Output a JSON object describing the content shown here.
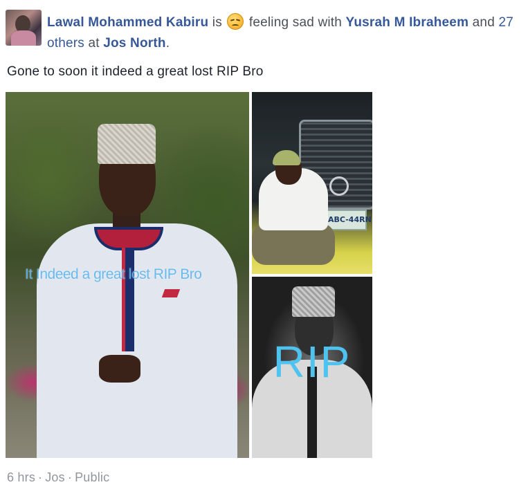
{
  "post": {
    "author": "Lawal Mohammed Kabiru",
    "is_word": "is",
    "feeling": "feeling sad with",
    "tagged_person": "Yusrah M Ibraheem",
    "and_word": "and",
    "others_count": "27",
    "others_word": "others",
    "at_word": "at",
    "location": "Jos North",
    "period": ".",
    "emoji_icon": "sad-face-emoji",
    "text": "Gone to soon it indeed a great lost RIP Bro"
  },
  "photos": {
    "main_overlay": "It Indeed a great lost RIP Bro",
    "plate_text": "ABC-44RN",
    "bottom_overlay": "RIP"
  },
  "footer": {
    "time": "6 hrs",
    "separator": "·",
    "place": "Jos",
    "privacy": "Public"
  }
}
